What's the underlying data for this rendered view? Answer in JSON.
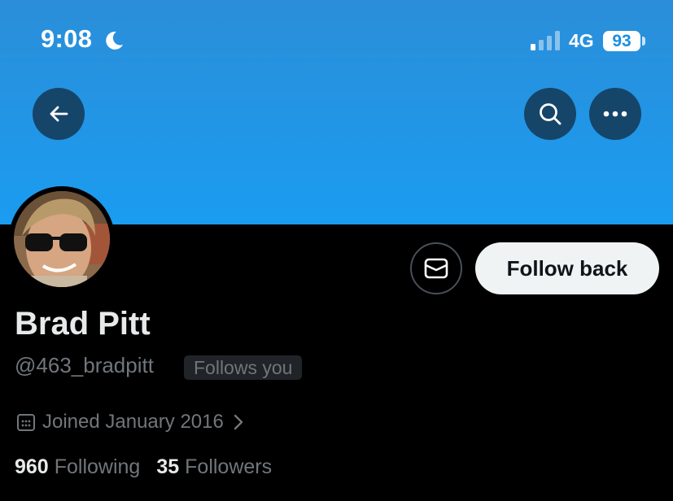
{
  "status_bar": {
    "time": "9:08",
    "network": "4G",
    "battery": "93"
  },
  "colors": {
    "banner_top": "#2b8ed9",
    "banner_bottom": "#1a9cf0",
    "background": "#000000",
    "primary_text": "#e7e9ea",
    "secondary_text": "#71767b",
    "follow_button_bg": "#eff3f4"
  },
  "header": {
    "icons": [
      "arrow-left-icon",
      "search-icon",
      "more-horizontal-icon"
    ]
  },
  "actions": {
    "message_icon": "envelope-icon",
    "follow_label": "Follow back"
  },
  "profile": {
    "display_name": "Brad Pitt",
    "handle": "@463_bradpitt",
    "follows_you": "Follows you",
    "joined": "Joined January 2016",
    "following_count": "960",
    "following_label": "Following",
    "followers_count": "35",
    "followers_label": "Followers"
  }
}
